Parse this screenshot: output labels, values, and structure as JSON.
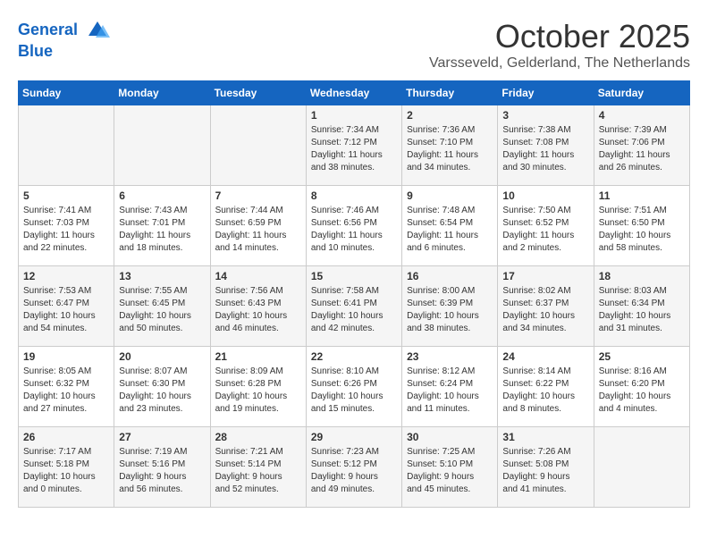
{
  "header": {
    "logo_line1": "General",
    "logo_line2": "Blue",
    "month": "October 2025",
    "location": "Varsseveld, Gelderland, The Netherlands"
  },
  "days_of_week": [
    "Sunday",
    "Monday",
    "Tuesday",
    "Wednesday",
    "Thursday",
    "Friday",
    "Saturday"
  ],
  "weeks": [
    [
      {
        "day": "",
        "info": ""
      },
      {
        "day": "",
        "info": ""
      },
      {
        "day": "",
        "info": ""
      },
      {
        "day": "1",
        "info": "Sunrise: 7:34 AM\nSunset: 7:12 PM\nDaylight: 11 hours\nand 38 minutes."
      },
      {
        "day": "2",
        "info": "Sunrise: 7:36 AM\nSunset: 7:10 PM\nDaylight: 11 hours\nand 34 minutes."
      },
      {
        "day": "3",
        "info": "Sunrise: 7:38 AM\nSunset: 7:08 PM\nDaylight: 11 hours\nand 30 minutes."
      },
      {
        "day": "4",
        "info": "Sunrise: 7:39 AM\nSunset: 7:06 PM\nDaylight: 11 hours\nand 26 minutes."
      }
    ],
    [
      {
        "day": "5",
        "info": "Sunrise: 7:41 AM\nSunset: 7:03 PM\nDaylight: 11 hours\nand 22 minutes."
      },
      {
        "day": "6",
        "info": "Sunrise: 7:43 AM\nSunset: 7:01 PM\nDaylight: 11 hours\nand 18 minutes."
      },
      {
        "day": "7",
        "info": "Sunrise: 7:44 AM\nSunset: 6:59 PM\nDaylight: 11 hours\nand 14 minutes."
      },
      {
        "day": "8",
        "info": "Sunrise: 7:46 AM\nSunset: 6:56 PM\nDaylight: 11 hours\nand 10 minutes."
      },
      {
        "day": "9",
        "info": "Sunrise: 7:48 AM\nSunset: 6:54 PM\nDaylight: 11 hours\nand 6 minutes."
      },
      {
        "day": "10",
        "info": "Sunrise: 7:50 AM\nSunset: 6:52 PM\nDaylight: 11 hours\nand 2 minutes."
      },
      {
        "day": "11",
        "info": "Sunrise: 7:51 AM\nSunset: 6:50 PM\nDaylight: 10 hours\nand 58 minutes."
      }
    ],
    [
      {
        "day": "12",
        "info": "Sunrise: 7:53 AM\nSunset: 6:47 PM\nDaylight: 10 hours\nand 54 minutes."
      },
      {
        "day": "13",
        "info": "Sunrise: 7:55 AM\nSunset: 6:45 PM\nDaylight: 10 hours\nand 50 minutes."
      },
      {
        "day": "14",
        "info": "Sunrise: 7:56 AM\nSunset: 6:43 PM\nDaylight: 10 hours\nand 46 minutes."
      },
      {
        "day": "15",
        "info": "Sunrise: 7:58 AM\nSunset: 6:41 PM\nDaylight: 10 hours\nand 42 minutes."
      },
      {
        "day": "16",
        "info": "Sunrise: 8:00 AM\nSunset: 6:39 PM\nDaylight: 10 hours\nand 38 minutes."
      },
      {
        "day": "17",
        "info": "Sunrise: 8:02 AM\nSunset: 6:37 PM\nDaylight: 10 hours\nand 34 minutes."
      },
      {
        "day": "18",
        "info": "Sunrise: 8:03 AM\nSunset: 6:34 PM\nDaylight: 10 hours\nand 31 minutes."
      }
    ],
    [
      {
        "day": "19",
        "info": "Sunrise: 8:05 AM\nSunset: 6:32 PM\nDaylight: 10 hours\nand 27 minutes."
      },
      {
        "day": "20",
        "info": "Sunrise: 8:07 AM\nSunset: 6:30 PM\nDaylight: 10 hours\nand 23 minutes."
      },
      {
        "day": "21",
        "info": "Sunrise: 8:09 AM\nSunset: 6:28 PM\nDaylight: 10 hours\nand 19 minutes."
      },
      {
        "day": "22",
        "info": "Sunrise: 8:10 AM\nSunset: 6:26 PM\nDaylight: 10 hours\nand 15 minutes."
      },
      {
        "day": "23",
        "info": "Sunrise: 8:12 AM\nSunset: 6:24 PM\nDaylight: 10 hours\nand 11 minutes."
      },
      {
        "day": "24",
        "info": "Sunrise: 8:14 AM\nSunset: 6:22 PM\nDaylight: 10 hours\nand 8 minutes."
      },
      {
        "day": "25",
        "info": "Sunrise: 8:16 AM\nSunset: 6:20 PM\nDaylight: 10 hours\nand 4 minutes."
      }
    ],
    [
      {
        "day": "26",
        "info": "Sunrise: 7:17 AM\nSunset: 5:18 PM\nDaylight: 10 hours\nand 0 minutes."
      },
      {
        "day": "27",
        "info": "Sunrise: 7:19 AM\nSunset: 5:16 PM\nDaylight: 9 hours\nand 56 minutes."
      },
      {
        "day": "28",
        "info": "Sunrise: 7:21 AM\nSunset: 5:14 PM\nDaylight: 9 hours\nand 52 minutes."
      },
      {
        "day": "29",
        "info": "Sunrise: 7:23 AM\nSunset: 5:12 PM\nDaylight: 9 hours\nand 49 minutes."
      },
      {
        "day": "30",
        "info": "Sunrise: 7:25 AM\nSunset: 5:10 PM\nDaylight: 9 hours\nand 45 minutes."
      },
      {
        "day": "31",
        "info": "Sunrise: 7:26 AM\nSunset: 5:08 PM\nDaylight: 9 hours\nand 41 minutes."
      },
      {
        "day": "",
        "info": ""
      }
    ]
  ]
}
